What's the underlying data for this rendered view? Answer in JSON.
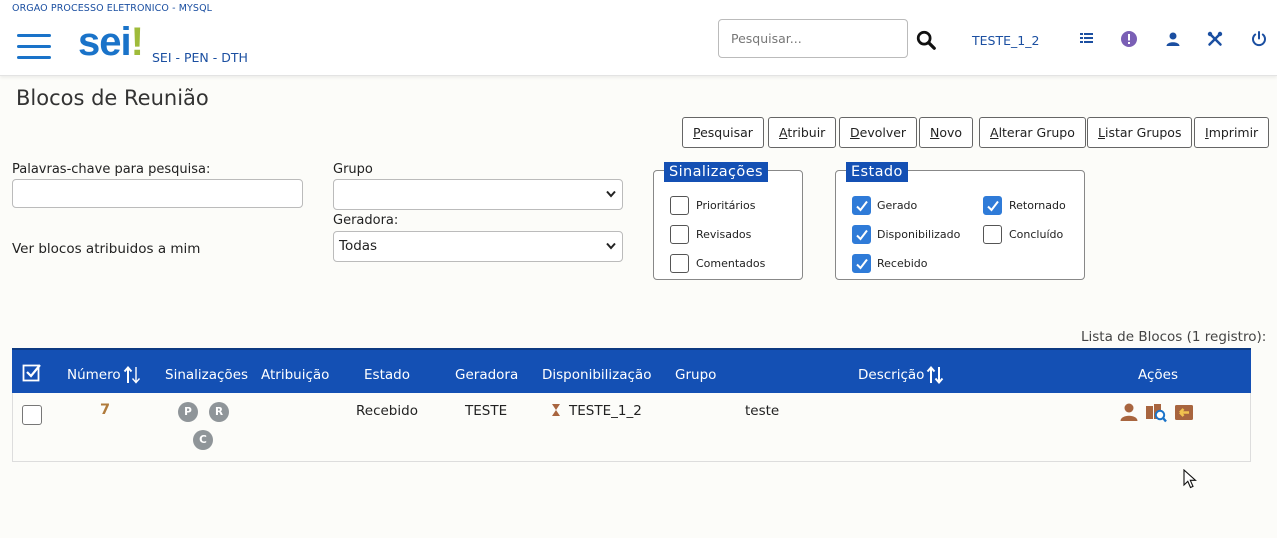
{
  "header": {
    "org_name": "ORGAO PROCESSO ELETRONICO - MYSQL",
    "logo_text": "sei",
    "logo_mark": "!",
    "subtitle": "SEI - PEN - DTH",
    "search_placeholder": "Pesquisar...",
    "user": "TESTE_1_2",
    "icons": [
      "menu-icon",
      "search-icon",
      "list-icon",
      "alert-icon",
      "user-icon",
      "tools-icon",
      "power-icon"
    ]
  },
  "page": {
    "title": "Blocos de Reunião"
  },
  "toolbar": {
    "buttons": [
      {
        "accel": "P",
        "rest": "esquisar"
      },
      {
        "accel": "A",
        "rest": "tribuir"
      },
      {
        "accel": "D",
        "rest": "evolver"
      },
      {
        "accel": "N",
        "rest": "ovo"
      },
      {
        "accel": "A",
        "rest": "lterar Grupo"
      },
      {
        "accel": "L",
        "rest": "istar Grupos"
      },
      {
        "accel": "I",
        "rest": "mprimir"
      }
    ]
  },
  "filters": {
    "keywords_label": "Palavras-chave para pesquisa:",
    "keywords_value": "",
    "group_label": "Grupo",
    "group_value": "",
    "generator_label": "Geradora:",
    "generator_value": "Todas",
    "assigned_link": "Ver blocos atribuidos a mim"
  },
  "sinalizacoes": {
    "legend": "Sinalizações",
    "items": [
      {
        "label": "Prioritários",
        "checked": false
      },
      {
        "label": "Revisados",
        "checked": false
      },
      {
        "label": "Comentados",
        "checked": false
      }
    ]
  },
  "estado": {
    "legend": "Estado",
    "items": [
      {
        "label": "Gerado",
        "checked": true
      },
      {
        "label": "Disponibilizado",
        "checked": true
      },
      {
        "label": "Recebido",
        "checked": true
      },
      {
        "label": "Retornado",
        "checked": true
      },
      {
        "label": "Concluído",
        "checked": false
      }
    ]
  },
  "table": {
    "caption": "Lista de Blocos (1 registro):",
    "columns": [
      "Número",
      "Sinalizações",
      "Atribuição",
      "Estado",
      "Geradora",
      "Disponibilização",
      "Grupo",
      "Descrição",
      "Ações"
    ],
    "rows": [
      {
        "numero": "7",
        "sinalizacoes": [
          "P",
          "R",
          "C"
        ],
        "atribuicao": "",
        "estado": "Recebido",
        "geradora": "TESTE",
        "disponibilizacao": "TESTE_1_2",
        "grupo": "",
        "descricao": "teste",
        "acoes": [
          "user-action-icon",
          "search-documents-icon",
          "return-block-icon"
        ]
      }
    ]
  },
  "colors": {
    "primary": "#1450b4",
    "link": "#1b4fa1",
    "accent_green": "#9fbb3a",
    "number_link": "#b07b3c",
    "action_icon": "#a8653f"
  }
}
